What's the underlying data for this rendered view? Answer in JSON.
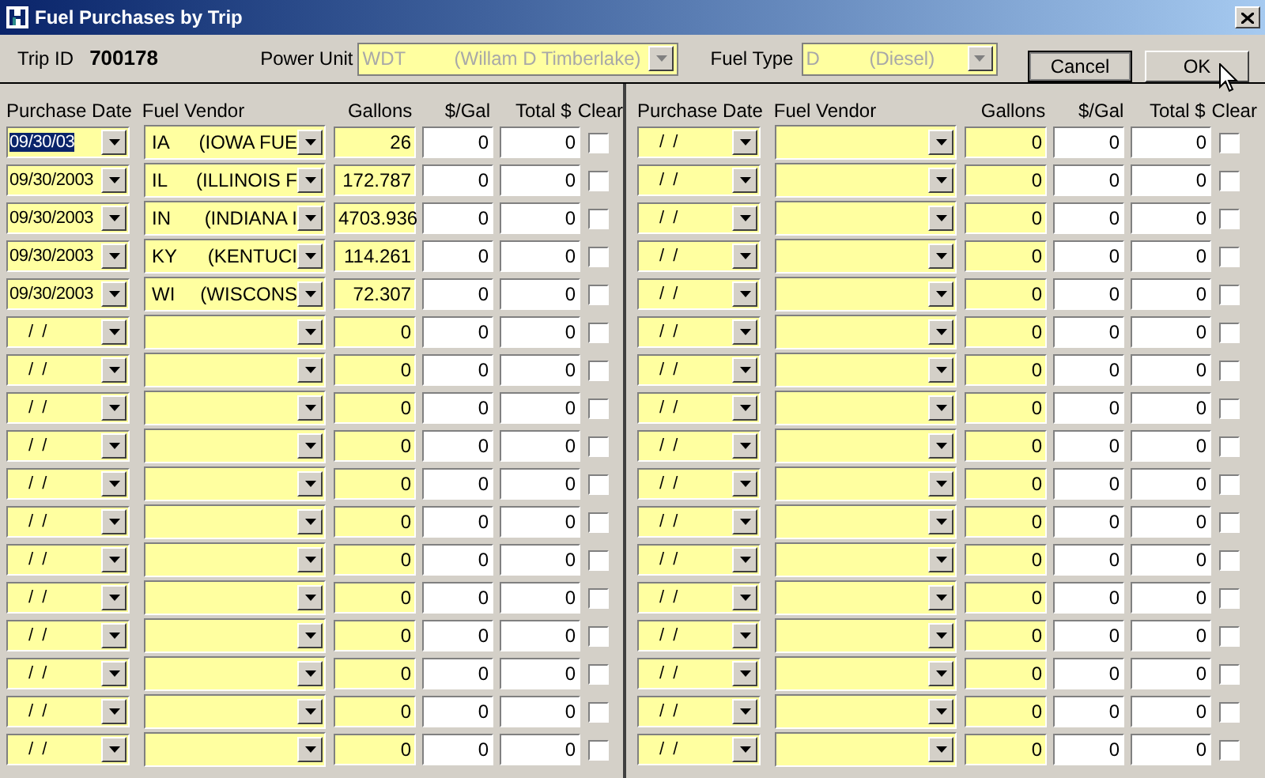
{
  "window": {
    "title": "Fuel Purchases by Trip"
  },
  "header": {
    "trip_id_label": "Trip ID",
    "trip_id": "700178",
    "power_unit_label": "Power Unit",
    "power_unit_code": "WDT",
    "power_unit_name": "(Willam D Timberlake)",
    "fuel_type_label": "Fuel Type",
    "fuel_type_code": "D",
    "fuel_type_name": "(Diesel)",
    "disabled": true
  },
  "buttons": [
    {
      "label": "Cancel",
      "default": true
    },
    {
      "label": "OK",
      "default": false
    }
  ],
  "panels": [
    {
      "columns": [
        "Purchase Date",
        "Fuel Vendor",
        "Gallons",
        "$/Gal",
        "Total $",
        "Clear"
      ],
      "rows": [
        {
          "date": "09/30/03",
          "selected": true,
          "vendor_code": "IA",
          "vendor_name": "(IOWA FUE",
          "gallons": "26",
          "price": "0",
          "total": "0",
          "checked": false
        },
        {
          "date": "09/30/2003",
          "selected": false,
          "vendor_code": "IL",
          "vendor_name": "(ILLINOIS F",
          "gallons": "172.787",
          "price": "0",
          "total": "0",
          "checked": false
        },
        {
          "date": "09/30/2003",
          "selected": false,
          "vendor_code": "IN",
          "vendor_name": "(INDIANA I",
          "gallons": "4703.936",
          "price": "0",
          "total": "0",
          "checked": false
        },
        {
          "date": "09/30/2003",
          "selected": false,
          "vendor_code": "KY",
          "vendor_name": "(KENTUCI",
          "gallons": "114.261",
          "price": "0",
          "total": "0",
          "checked": false
        },
        {
          "date": "09/30/2003",
          "selected": false,
          "vendor_code": "WI",
          "vendor_name": "(WISCONS",
          "gallons": "72.307",
          "price": "0",
          "total": "0",
          "checked": false
        },
        {
          "date": "/  /",
          "selected": false,
          "gallons": "0",
          "price": "0",
          "total": "0",
          "checked": false
        },
        {
          "date": "/  /",
          "selected": false,
          "gallons": "0",
          "price": "0",
          "total": "0",
          "checked": false
        },
        {
          "date": "/  /",
          "selected": false,
          "gallons": "0",
          "price": "0",
          "total": "0",
          "checked": false
        },
        {
          "date": "/  /",
          "selected": false,
          "gallons": "0",
          "price": "0",
          "total": "0",
          "checked": false
        },
        {
          "date": "/  /",
          "selected": false,
          "gallons": "0",
          "price": "0",
          "total": "0",
          "checked": false
        },
        {
          "date": "/  /",
          "selected": false,
          "gallons": "0",
          "price": "0",
          "total": "0",
          "checked": false
        },
        {
          "date": "/  /",
          "selected": false,
          "gallons": "0",
          "price": "0",
          "total": "0",
          "checked": false
        },
        {
          "date": "/  /",
          "selected": false,
          "gallons": "0",
          "price": "0",
          "total": "0",
          "checked": false
        },
        {
          "date": "/  /",
          "selected": false,
          "gallons": "0",
          "price": "0",
          "total": "0",
          "checked": false
        },
        {
          "date": "/  /",
          "selected": false,
          "gallons": "0",
          "price": "0",
          "total": "0",
          "checked": false
        },
        {
          "date": "/  /",
          "selected": false,
          "gallons": "0",
          "price": "0",
          "total": "0",
          "checked": false
        },
        {
          "date": "/  /",
          "selected": false,
          "gallons": "0",
          "price": "0",
          "total": "0",
          "checked": false
        }
      ]
    },
    {
      "columns": [
        "Purchase Date",
        "Fuel Vendor",
        "Gallons",
        "$/Gal",
        "Total $",
        "Clear"
      ],
      "rows": [
        {
          "date": "/  /",
          "selected": false,
          "gallons": "0",
          "price": "0",
          "total": "0",
          "checked": false
        },
        {
          "date": "/  /",
          "selected": false,
          "gallons": "0",
          "price": "0",
          "total": "0",
          "checked": false
        },
        {
          "date": "/  /",
          "selected": false,
          "gallons": "0",
          "price": "0",
          "total": "0",
          "checked": false
        },
        {
          "date": "/  /",
          "selected": false,
          "gallons": "0",
          "price": "0",
          "total": "0",
          "checked": false
        },
        {
          "date": "/  /",
          "selected": false,
          "gallons": "0",
          "price": "0",
          "total": "0",
          "checked": false
        },
        {
          "date": "/  /",
          "selected": false,
          "gallons": "0",
          "price": "0",
          "total": "0",
          "checked": false
        },
        {
          "date": "/  /",
          "selected": false,
          "gallons": "0",
          "price": "0",
          "total": "0",
          "checked": false
        },
        {
          "date": "/  /",
          "selected": false,
          "gallons": "0",
          "price": "0",
          "total": "0",
          "checked": false
        },
        {
          "date": "/  /",
          "selected": false,
          "gallons": "0",
          "price": "0",
          "total": "0",
          "checked": false
        },
        {
          "date": "/  /",
          "selected": false,
          "gallons": "0",
          "price": "0",
          "total": "0",
          "checked": false
        },
        {
          "date": "/  /",
          "selected": false,
          "gallons": "0",
          "price": "0",
          "total": "0",
          "checked": false
        },
        {
          "date": "/  /",
          "selected": false,
          "gallons": "0",
          "price": "0",
          "total": "0",
          "checked": false
        },
        {
          "date": "/  /",
          "selected": false,
          "gallons": "0",
          "price": "0",
          "total": "0",
          "checked": false
        },
        {
          "date": "/  /",
          "selected": false,
          "gallons": "0",
          "price": "0",
          "total": "0",
          "checked": false
        },
        {
          "date": "/  /",
          "selected": false,
          "gallons": "0",
          "price": "0",
          "total": "0",
          "checked": false
        },
        {
          "date": "/  /",
          "selected": false,
          "gallons": "0",
          "price": "0",
          "total": "0",
          "checked": false
        },
        {
          "date": "/  /",
          "selected": false,
          "gallons": "0",
          "price": "0",
          "total": "0",
          "checked": false
        }
      ]
    }
  ]
}
